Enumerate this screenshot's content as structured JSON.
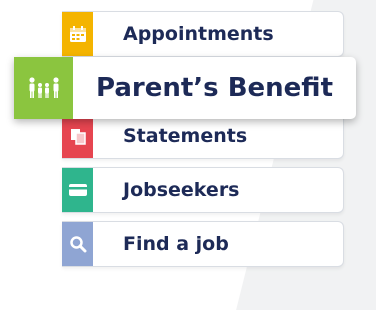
{
  "menu": {
    "items": [
      {
        "label": "Appointments",
        "color": "#f4b400",
        "icon": "calendar-icon"
      },
      {
        "label": "Parent’s Benefit",
        "color": "#8bc53f",
        "icon": "family-icon"
      },
      {
        "label": "Statements",
        "color": "#e64550",
        "icon": "documents-icon"
      },
      {
        "label": "Jobseekers",
        "color": "#2fb58d",
        "icon": "card-icon"
      },
      {
        "label": "Find a job",
        "color": "#8fa5d3",
        "icon": "search-icon"
      }
    ]
  }
}
